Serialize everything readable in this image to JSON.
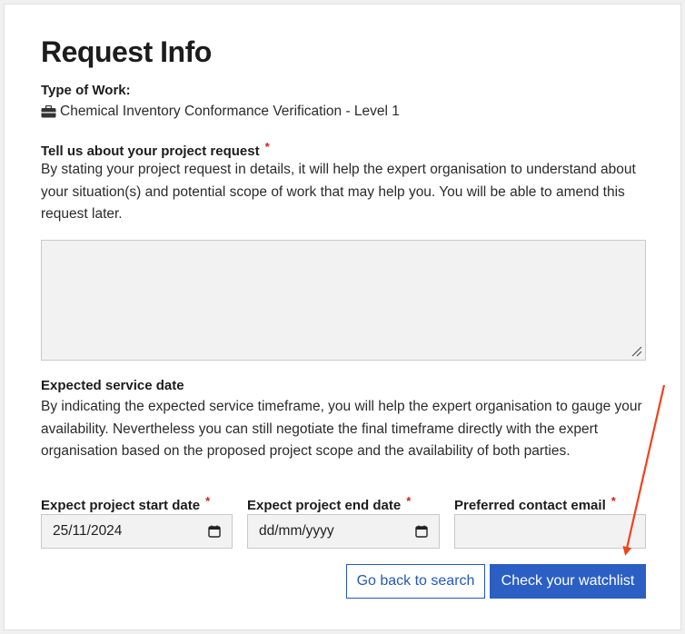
{
  "page": {
    "title": "Request Info"
  },
  "type_of_work": {
    "label": "Type of Work:",
    "icon": "briefcase-icon",
    "value": "Chemical Inventory Conformance Verification - Level 1"
  },
  "project_request": {
    "label": "Tell us about your project request",
    "required_mark": "*",
    "description": "By stating your project request in details, it will help the expert organisation to understand about your situation(s) and potential scope of work that may help you. You will be able to amend this request later.",
    "value": ""
  },
  "expected_service": {
    "label": "Expected service date",
    "description": "By indicating the expected service timeframe, you will help the expert organisation to gauge your availability. Nevertheless you can still negotiate the final timeframe directly with the expert organisation based on the proposed project scope and the availability of both parties."
  },
  "fields": {
    "start_date": {
      "label": "Expect project start date",
      "required_mark": "*",
      "value": "25/11/2024"
    },
    "end_date": {
      "label": "Expect project end date",
      "required_mark": "*",
      "value": "dd/mm/yyyy"
    },
    "email": {
      "label": "Preferred contact email",
      "required_mark": "*",
      "value": ""
    }
  },
  "buttons": {
    "back_label": "Go back to search",
    "watchlist_label": "Check your watchlist"
  },
  "colors": {
    "primary": "#2b5fc4",
    "required": "#d6221a",
    "annotation_arrow": "#f0421c"
  }
}
